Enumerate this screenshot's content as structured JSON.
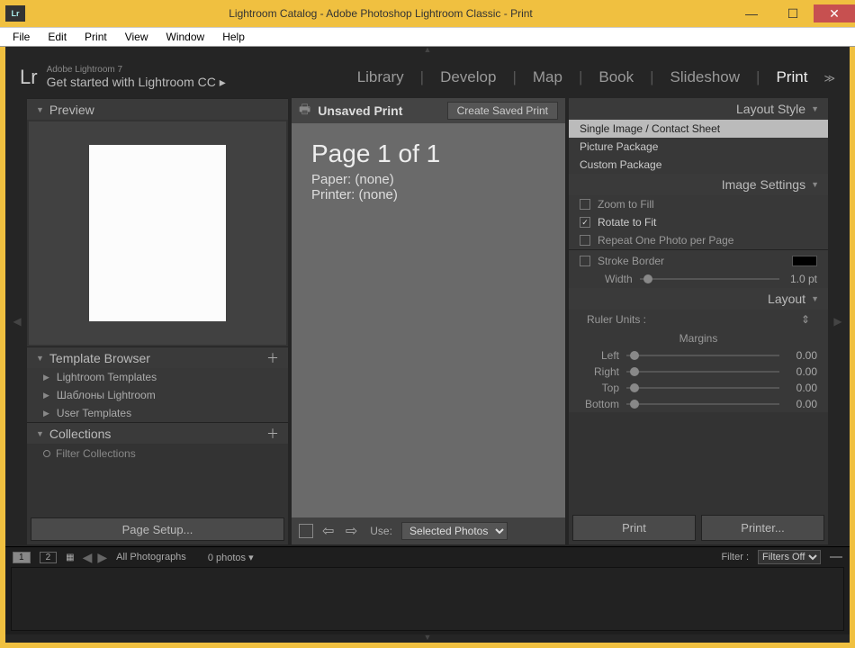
{
  "titlebar": {
    "icon": "Lr",
    "title": "Lightroom Catalog - Adobe Photoshop Lightroom Classic - Print"
  },
  "menubar": [
    "File",
    "Edit",
    "Print",
    "View",
    "Window",
    "Help"
  ],
  "identity": {
    "logo": "Lr",
    "small": "Adobe Lightroom 7",
    "big": "Get started with Lightroom CC ▸"
  },
  "modules": [
    "Library",
    "Develop",
    "Map",
    "Book",
    "Slideshow",
    "Print"
  ],
  "module_active": "Print",
  "left": {
    "preview_label": "Preview",
    "template_label": "Template Browser",
    "templates": [
      "Lightroom Templates",
      "Шаблоны Lightroom",
      "User Templates"
    ],
    "collections_label": "Collections",
    "filter_collections": "Filter Collections",
    "page_setup": "Page Setup..."
  },
  "center": {
    "title": "Unsaved Print",
    "create_btn": "Create Saved Print",
    "page_line": "Page 1 of 1",
    "paper_line": "Paper: (none)",
    "printer_line": "Printer: (none)",
    "use_label": "Use:",
    "use_value": "Selected Photos"
  },
  "right": {
    "layout_style": "Layout Style",
    "styles": [
      "Single Image / Contact Sheet",
      "Picture Package",
      "Custom Package"
    ],
    "image_settings": "Image Settings",
    "zoom_to_fill": "Zoom to Fill",
    "rotate_to_fit": "Rotate to Fit",
    "repeat": "Repeat One Photo per Page",
    "stroke_border": "Stroke Border",
    "width_label": "Width",
    "width_val": "1.0 pt",
    "layout": "Layout",
    "ruler_units": "Ruler Units :",
    "margins_label": "Margins",
    "margins": [
      {
        "lbl": "Left",
        "val": "0.00"
      },
      {
        "lbl": "Right",
        "val": "0.00"
      },
      {
        "lbl": "Top",
        "val": "0.00"
      },
      {
        "lbl": "Bottom",
        "val": "0.00"
      }
    ],
    "print_btn": "Print",
    "printer_btn": "Printer..."
  },
  "filmstrip": {
    "display1": "1",
    "display2": "2",
    "source": "All Photographs",
    "count": "0 photos",
    "filter_label": "Filter :",
    "filter_value": "Filters Off"
  }
}
